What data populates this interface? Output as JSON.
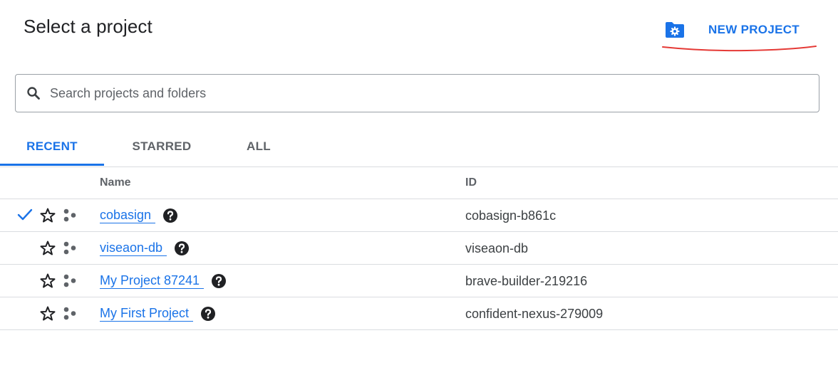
{
  "dialog": {
    "title": "Select a project",
    "new_project_label": "NEW PROJECT",
    "new_project_icon": "folder-settings-icon",
    "annotation_color": "#e53935"
  },
  "search": {
    "placeholder": "Search projects and folders",
    "value": ""
  },
  "tabs": [
    {
      "label": "RECENT",
      "active": true
    },
    {
      "label": "STARRED",
      "active": false
    },
    {
      "label": "ALL",
      "active": false
    }
  ],
  "table": {
    "columns": {
      "name": "Name",
      "id": "ID"
    },
    "rows": [
      {
        "name": "cobasign",
        "id": "cobasign-b861c",
        "selected": true
      },
      {
        "name": "viseaon-db",
        "id": "viseaon-db",
        "selected": false
      },
      {
        "name": "My Project 87241",
        "id": "brave-builder-219216",
        "selected": false
      },
      {
        "name": "My First Project",
        "id": "confident-nexus-279009",
        "selected": false
      }
    ]
  },
  "colors": {
    "accent": "#1a73e8",
    "text": "#202124",
    "muted": "#5f6368",
    "divider": "#dadce0"
  }
}
